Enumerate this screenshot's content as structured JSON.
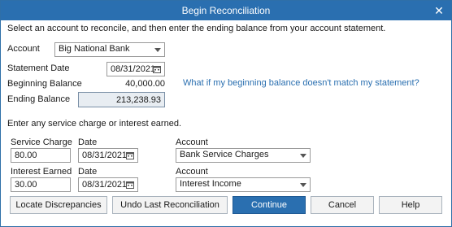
{
  "window": {
    "title": "Begin Reconciliation",
    "close_glyph": "✕"
  },
  "intro": "Select an account to reconcile, and then enter the ending balance from your account statement.",
  "account": {
    "label": "Account",
    "value": "Big National Bank"
  },
  "statement_date": {
    "label": "Statement Date",
    "value": "08/31/2021"
  },
  "beginning_balance": {
    "label": "Beginning Balance",
    "value": "40,000.00"
  },
  "beginning_balance_link": "What if my beginning balance doesn't match my statement?",
  "ending_balance": {
    "label": "Ending Balance",
    "value": "213,238.93"
  },
  "service_intro": "Enter any service charge or interest earned.",
  "service_charge": {
    "label": "Service Charge",
    "value": "80.00",
    "date_label": "Date",
    "date_value": "08/31/2021",
    "account_label": "Account",
    "account_value": "Bank Service Charges"
  },
  "interest_earned": {
    "label": "Interest Earned",
    "value": "30.00",
    "date_label": "Date",
    "date_value": "08/31/2021",
    "account_label": "Account",
    "account_value": "Interest Income"
  },
  "buttons": {
    "locate": "Locate Discrepancies",
    "undo": "Undo Last Reconciliation",
    "continue": "Continue",
    "cancel": "Cancel",
    "help": "Help"
  },
  "colors": {
    "title_bar": "#2a6fb0",
    "link": "#2a6fb0",
    "primary_button": "#2a6fb0"
  },
  "icons": {
    "close": "close-icon",
    "calendar": "calendar-icon",
    "dropdown": "chevron-down-icon"
  }
}
